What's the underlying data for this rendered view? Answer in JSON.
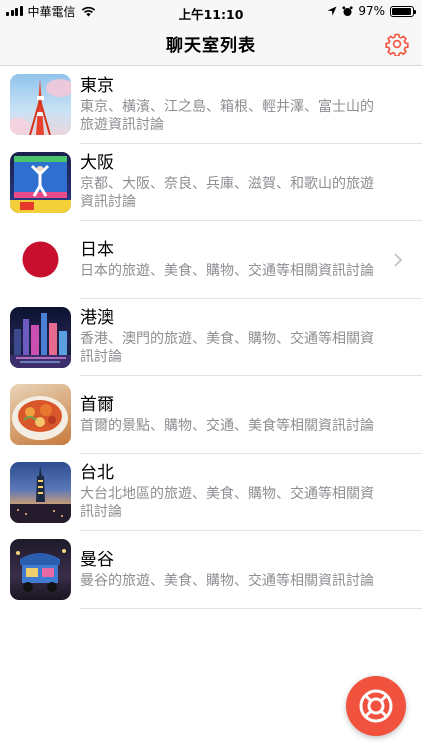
{
  "status_bar": {
    "carrier": "中華電信",
    "time": "上午11:10",
    "battery": "97%",
    "battery_level": 0.97
  },
  "nav": {
    "title": "聊天室列表",
    "settings_icon": "gear-icon"
  },
  "colors": {
    "accent": "#f0523e",
    "secondary_text": "#8e8e93"
  },
  "rooms": [
    {
      "title": "東京",
      "desc": "東京、橫濱、江之島、箱根、輕井澤、富士山的旅遊資訊討論",
      "icon": "tokyo-tower-photo"
    },
    {
      "title": "大阪",
      "desc": "京都、大阪、奈良、兵庫、滋賀、和歌山的旅遊資訊討論",
      "icon": "osaka-glico-sign-photo"
    },
    {
      "title": "日本",
      "desc": "日本的旅遊、美食、購物、交通等相關資訊討論",
      "icon": "japan-flag"
    },
    {
      "title": "港澳",
      "desc": "香港、澳門的旅遊、美食、購物、交通等相關資訊討論",
      "icon": "hong-kong-skyline-photo"
    },
    {
      "title": "首爾",
      "desc": "首爾的景點、購物、交通、美食等相關資訊討論",
      "icon": "korean-food-photo"
    },
    {
      "title": "台北",
      "desc": "大台北地區的旅遊、美食、購物、交通等相關資訊討論",
      "icon": "taipei-101-photo"
    },
    {
      "title": "曼谷",
      "desc": "曼谷的旅遊、美食、購物、交通等相關資訊討論",
      "icon": "tuk-tuk-photo"
    }
  ],
  "fab": {
    "icon": "lifebuoy-icon"
  }
}
